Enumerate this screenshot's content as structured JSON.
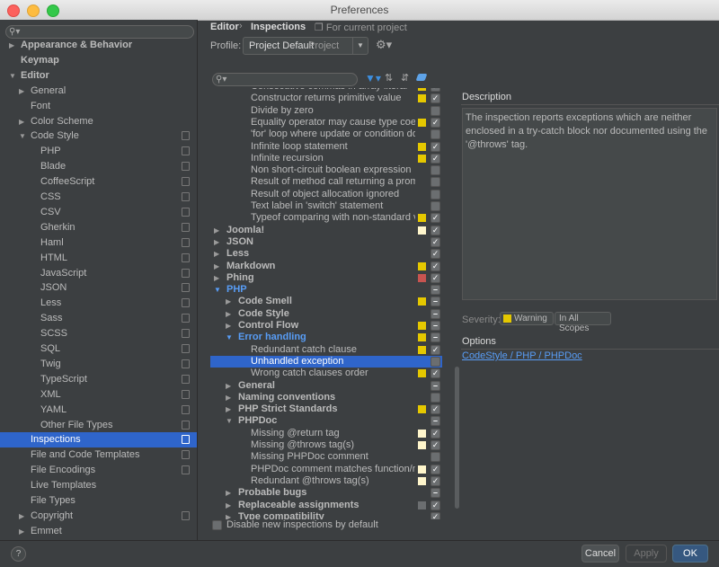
{
  "window": {
    "title": "Preferences"
  },
  "sidebar": {
    "items": [
      {
        "label": "Appearance & Behavior",
        "bold": true,
        "arrow": "right"
      },
      {
        "label": "Keymap",
        "bold": true
      },
      {
        "label": "Editor",
        "bold": true,
        "arrow": "down"
      },
      {
        "label": "General",
        "arrow": "right"
      },
      {
        "label": "Font"
      },
      {
        "label": "Color Scheme",
        "arrow": "right"
      },
      {
        "label": "Code Style",
        "arrow": "down",
        "copy": true
      },
      {
        "label": "PHP",
        "copy": true
      },
      {
        "label": "Blade",
        "copy": true
      },
      {
        "label": "CoffeeScript",
        "copy": true
      },
      {
        "label": "CSS",
        "copy": true
      },
      {
        "label": "CSV",
        "copy": true
      },
      {
        "label": "Gherkin",
        "copy": true
      },
      {
        "label": "Haml",
        "copy": true
      },
      {
        "label": "HTML",
        "copy": true
      },
      {
        "label": "JavaScript",
        "copy": true
      },
      {
        "label": "JSON",
        "copy": true
      },
      {
        "label": "Less",
        "copy": true
      },
      {
        "label": "Sass",
        "copy": true
      },
      {
        "label": "SCSS",
        "copy": true
      },
      {
        "label": "SQL",
        "copy": true
      },
      {
        "label": "Twig",
        "copy": true
      },
      {
        "label": "TypeScript",
        "copy": true
      },
      {
        "label": "XML",
        "copy": true
      },
      {
        "label": "YAML",
        "copy": true
      },
      {
        "label": "Other File Types",
        "copy": true
      },
      {
        "label": "Inspections",
        "selected": true,
        "copy": true
      },
      {
        "label": "File and Code Templates",
        "copy": true
      },
      {
        "label": "File Encodings",
        "copy": true
      },
      {
        "label": "Live Templates"
      },
      {
        "label": "File Types"
      },
      {
        "label": "Copyright",
        "arrow": "right",
        "copy": true
      },
      {
        "label": "Emmet",
        "arrow": "right"
      }
    ]
  },
  "header": {
    "crumb1": "Editor",
    "separator": "›",
    "crumb2": "Inspections",
    "scope_note": "For current project"
  },
  "profile": {
    "label": "Profile:",
    "value": "Project Default",
    "hint": "Project"
  },
  "inspections": [
    {
      "label": "Consecutive commas in array literal",
      "level": 3,
      "sev": "#e5c800",
      "check": "on"
    },
    {
      "label": "Constructor returns primitive value",
      "level": 3,
      "sev": "#e5c800",
      "check": "on"
    },
    {
      "label": "Divide by zero",
      "level": 3,
      "sev": "",
      "check": "off"
    },
    {
      "label": "Equality operator may cause type coercion",
      "level": 3,
      "sev": "#e5c800",
      "check": "on"
    },
    {
      "label": "'for' loop where update or condition does not use loop variable",
      "level": 3,
      "sev": "",
      "check": "off"
    },
    {
      "label": "Infinite loop statement",
      "level": 3,
      "sev": "#e5c800",
      "check": "on"
    },
    {
      "label": "Infinite recursion",
      "level": 3,
      "sev": "#e5c800",
      "check": "on"
    },
    {
      "label": "Non short-circuit boolean expression",
      "level": 3,
      "sev": "",
      "check": "off"
    },
    {
      "label": "Result of method call returning a promise is ignored",
      "level": 3,
      "sev": "",
      "check": "off"
    },
    {
      "label": "Result of object allocation ignored",
      "level": 3,
      "sev": "",
      "check": "off"
    },
    {
      "label": "Text label in 'switch' statement",
      "level": 3,
      "sev": "",
      "check": "off"
    },
    {
      "label": "Typeof comparing with non-standard value",
      "level": 3,
      "sev": "#e5c800",
      "check": "on"
    },
    {
      "label": "Joomla!",
      "level": 0,
      "bold": true,
      "arrow": "right",
      "sev": "#fff6cc",
      "check": "on"
    },
    {
      "label": "JSON",
      "level": 0,
      "bold": true,
      "arrow": "right",
      "sev": "",
      "check": "on"
    },
    {
      "label": "Less",
      "level": 0,
      "bold": true,
      "arrow": "right",
      "sev": "",
      "check": "on"
    },
    {
      "label": "Markdown",
      "level": 0,
      "bold": true,
      "arrow": "right",
      "sev": "#e5c800",
      "check": "on"
    },
    {
      "label": "Phing",
      "level": 0,
      "bold": true,
      "arrow": "right",
      "sev": "#c75450",
      "check": "on"
    },
    {
      "label": "PHP",
      "level": 0,
      "bold": true,
      "blue": true,
      "arrow": "down",
      "sev": "",
      "check": "mixed"
    },
    {
      "label": "Code Smell",
      "level": 1,
      "bold": true,
      "arrow": "right",
      "sev": "#e5c800",
      "check": "mixed"
    },
    {
      "label": "Code Style",
      "level": 1,
      "bold": true,
      "arrow": "right",
      "sev": "",
      "check": "mixed"
    },
    {
      "label": "Control Flow",
      "level": 1,
      "bold": true,
      "arrow": "right",
      "sev": "#e5c800",
      "check": "mixed"
    },
    {
      "label": "Error handling",
      "level": 1,
      "bold": true,
      "blue": true,
      "arrow": "down",
      "sev": "#e5c800",
      "check": "mixed"
    },
    {
      "label": "Redundant catch clause",
      "level": 3,
      "sev": "#e5c800",
      "check": "on"
    },
    {
      "label": "Unhandled exception",
      "level": 3,
      "sev": "",
      "check": "off",
      "selected": true
    },
    {
      "label": "Wrong catch clauses order",
      "level": 3,
      "sev": "#e5c800",
      "check": "on"
    },
    {
      "label": "General",
      "level": 1,
      "bold": true,
      "arrow": "right",
      "sev": "",
      "check": "mixed"
    },
    {
      "label": "Naming conventions",
      "level": 1,
      "bold": true,
      "arrow": "right",
      "sev": "",
      "check": "off"
    },
    {
      "label": "PHP Strict Standards",
      "level": 1,
      "bold": true,
      "arrow": "right",
      "sev": "#e5c800",
      "check": "on"
    },
    {
      "label": "PHPDoc",
      "level": 1,
      "bold": true,
      "arrow": "down",
      "sev": "",
      "check": "mixed"
    },
    {
      "label": "Missing @return tag",
      "level": 3,
      "sev": "#fff6cc",
      "check": "on"
    },
    {
      "label": "Missing @throws tag(s)",
      "level": 3,
      "sev": "#fff6cc",
      "check": "on"
    },
    {
      "label": "Missing PHPDoc comment",
      "level": 3,
      "sev": "",
      "check": "off"
    },
    {
      "label": "PHPDoc comment matches function/method signature",
      "level": 3,
      "sev": "#fff6cc",
      "check": "on"
    },
    {
      "label": "Redundant @throws tag(s)",
      "level": 3,
      "sev": "#fff6cc",
      "check": "on"
    },
    {
      "label": "Probable bugs",
      "level": 1,
      "bold": true,
      "arrow": "right",
      "sev": "",
      "check": "mixed"
    },
    {
      "label": "Replaceable assignments",
      "level": 1,
      "bold": true,
      "arrow": "right",
      "sev": "#6b6e70",
      "check": "on"
    },
    {
      "label": "Type compatibility",
      "level": 1,
      "bold": true,
      "arrow": "right",
      "sev": "",
      "check": "on"
    }
  ],
  "description": {
    "label": "Description",
    "text": "The inspection reports exceptions which are neither enclosed in a try-catch block nor documented using the '@throws' tag."
  },
  "severity": {
    "label": "Severity:",
    "value": "Warning",
    "scope": "In All Scopes"
  },
  "options": {
    "label": "Options",
    "link": "CodeStyle / PHP / PHPDoc"
  },
  "disable_default": {
    "label": "Disable new inspections by default"
  },
  "buttons": {
    "cancel": "Cancel",
    "apply": "Apply",
    "ok": "OK",
    "help": "?"
  },
  "icons": {
    "search": "search-icon",
    "filter": "filter-icon",
    "expand": "expand-all-icon",
    "collapse": "collapse-all-icon",
    "reset": "reset-icon",
    "gear": "gear-icon"
  }
}
